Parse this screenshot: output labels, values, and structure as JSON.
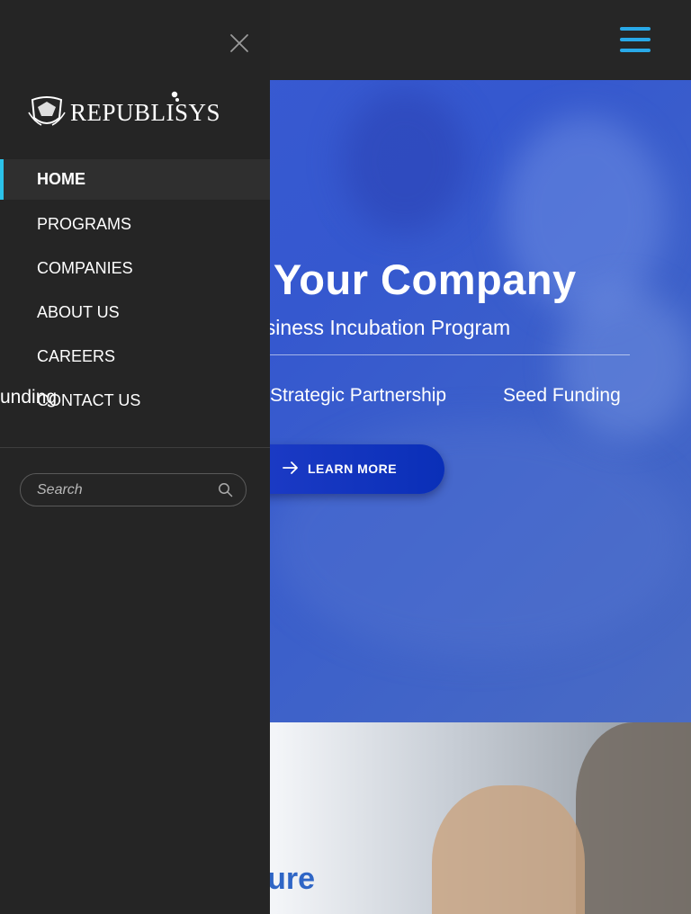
{
  "topbar": {
    "menu_icon": "hamburger-icon",
    "accent": "#29a9e8"
  },
  "hero": {
    "title": "n Your Company",
    "subtitle": "usiness Incubation Program",
    "features": [
      "Strategic Partnership",
      "Seed Funding"
    ],
    "overflow_feature": "unding",
    "cta_label": "LEARN MORE",
    "cta_icon": "arrow-right-icon"
  },
  "section2": {
    "heading": "nture"
  },
  "drawer": {
    "close_icon": "close-icon",
    "logo_text": "REPUBLISYS",
    "nav": [
      {
        "label": "HOME",
        "active": true
      },
      {
        "label": "PROGRAMS",
        "active": false
      },
      {
        "label": "COMPANIES",
        "active": false
      },
      {
        "label": "ABOUT US",
        "active": false
      },
      {
        "label": "CAREERS",
        "active": false
      },
      {
        "label": "CONTACT US",
        "active": false
      }
    ],
    "search": {
      "placeholder": "Search",
      "value": "",
      "icon": "search-icon"
    },
    "active_accent": "#2bc3ea"
  }
}
